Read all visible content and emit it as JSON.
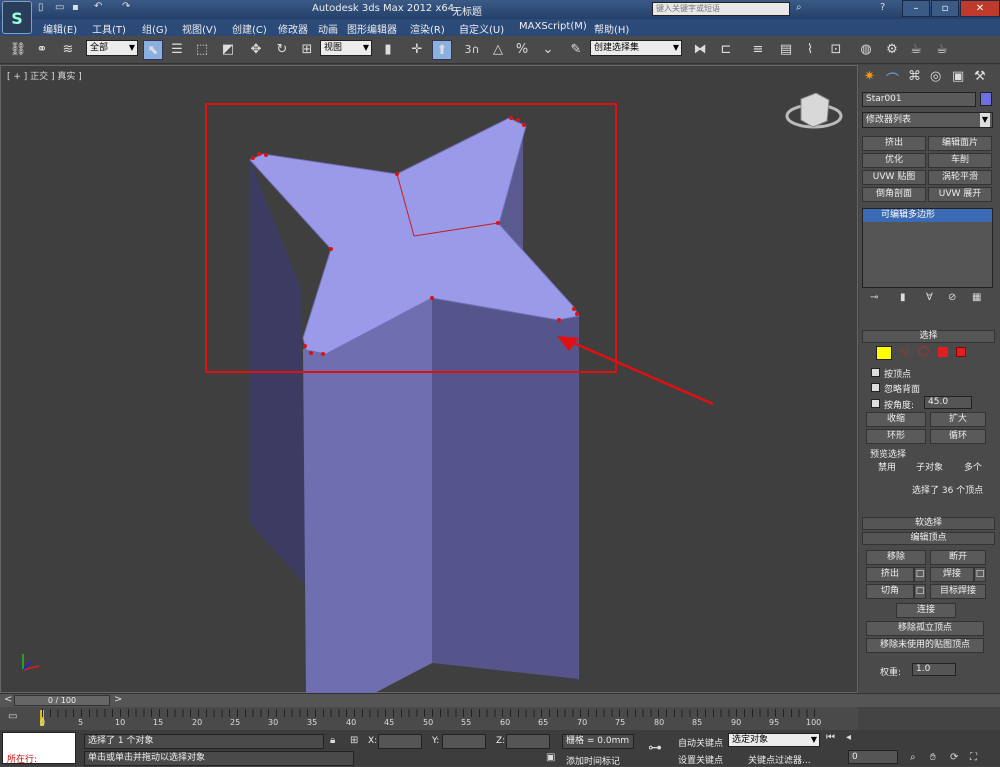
{
  "title": {
    "app": "Autodesk 3ds Max  2012 x64",
    "file": "无标题",
    "search_placeholder": "键入关键字或短语"
  },
  "menu": [
    "编辑(E)",
    "工具(T)",
    "组(G)",
    "视图(V)",
    "创建(C)",
    "修改器",
    "动画",
    "图形编辑器",
    "渲染(R)",
    "自定义(U)",
    "MAXScript(M)",
    "帮助(H)"
  ],
  "toolbar": {
    "filter": "全部",
    "refcoord": "视图",
    "selset": "创建选择集"
  },
  "viewport": {
    "label": "[ + ] 正交 ] 真实 ]"
  },
  "panel": {
    "object_name": "Star001",
    "modifier_list": "修改器列表",
    "mod_buttons": [
      "挤出",
      "编辑面片",
      "优化",
      "车削",
      "UVW 贴图",
      "涡轮平滑",
      "倒角剖面",
      "UVW 展开"
    ],
    "stack_item": "可编辑多边形",
    "selection": {
      "header": "选择",
      "by_vertex": "按顶点",
      "ignore_backface": "忽略背面",
      "by_angle": "按角度:",
      "angle_value": "45.0",
      "shrink": "收缩",
      "grow": "扩大",
      "ring": "环形",
      "loop": "循环",
      "preview": "预览选择",
      "preview_opts": [
        "禁用",
        "子对象",
        "多个"
      ],
      "info": "选择了 36 个顶点"
    },
    "soft_select": "软选择",
    "edit_vertices": {
      "header": "编辑顶点",
      "remove": "移除",
      "break": "断开",
      "extrude": "挤出",
      "weld": "焊接",
      "chamfer": "切角",
      "target_weld": "目标焊接",
      "connect": "连接",
      "remove_isolated": "移除孤立顶点",
      "remove_unused": "移除未使用的贴图顶点",
      "weight_label": "权重:",
      "weight_value": "1.0"
    }
  },
  "timeline": {
    "frame": "0 / 100",
    "ticks": [
      "0",
      "5",
      "10",
      "15",
      "20",
      "25",
      "30",
      "35",
      "40",
      "45",
      "50",
      "55",
      "60",
      "65",
      "70",
      "75",
      "80",
      "85",
      "90",
      "95",
      "100"
    ]
  },
  "status": {
    "script_label": "所在行:",
    "selected": "选择了 1 个对象",
    "hint": "单击或单击并拖动以选择对象",
    "x_label": "X:",
    "y_label": "Y:",
    "z_label": "Z:",
    "grid": "栅格 = 0.0mm",
    "add_time_tag": "添加时间标记",
    "auto_key": "自动关键点",
    "set_key": "设置关键点",
    "selected_obj": "选定对象",
    "key_filters": "关键点过滤器...",
    "frame_value": "0"
  },
  "colors": {
    "accent": "#3a6ab3",
    "object": "#9a9ae8",
    "highlight": "#e01010"
  }
}
